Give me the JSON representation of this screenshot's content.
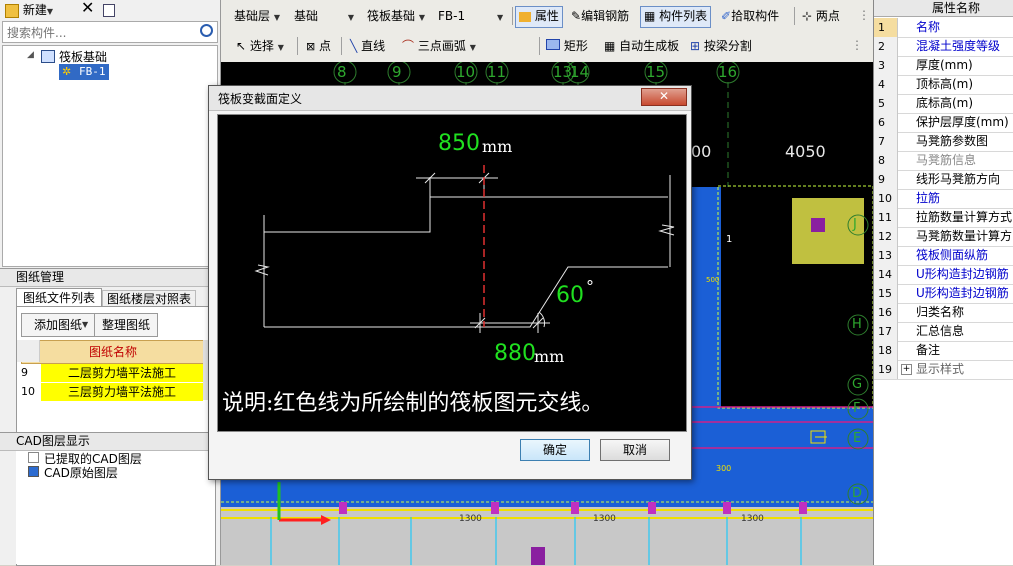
{
  "left_toolbar": {
    "new_label": "新建",
    "search_placeholder": "搜索构件..."
  },
  "tree": {
    "root": "筏板基础",
    "child": "FB-1"
  },
  "drawing_manage": {
    "title": "图纸管理",
    "tabs": [
      "图纸文件列表",
      "图纸楼层对照表"
    ],
    "add_label": "添加图纸",
    "organize_label": "整理图纸",
    "col_header": "图纸名称",
    "rows": [
      {
        "num": "9",
        "name": "二层剪力墙平法施工"
      },
      {
        "num": "10",
        "name": "三层剪力墙平法施工"
      }
    ]
  },
  "cad_layers": {
    "title": "CAD图层显示",
    "items": [
      "已提取的CAD图层",
      "CAD原始图层"
    ]
  },
  "toolbar1": {
    "floor": "基础层",
    "type": "基础",
    "category": "筏板基础",
    "component": "FB-1",
    "attr_label": "属性",
    "edit_rebar_label": "编辑钢筋",
    "comp_list_label": "构件列表",
    "pick_label": "拾取构件",
    "two_point_label": "两点"
  },
  "toolbar2": {
    "select_label": "选择",
    "point_label": "点",
    "line_label": "直线",
    "arc_label": "三点画弧",
    "rect_label": "矩形",
    "auto_label": "自动生成板",
    "split_label": "按梁分割"
  },
  "axes": {
    "top": [
      "8",
      "9",
      "10",
      "11",
      "13",
      "14",
      "15",
      "16"
    ],
    "right": [
      "J",
      "H",
      "G",
      "F",
      "E",
      "D"
    ]
  },
  "cad_dims": {
    "d00": "00",
    "d4050": "4050",
    "d1300a": "1300",
    "d1300b": "1300",
    "d1300c": "1300",
    "d300": "300",
    "d500": "500",
    "d1": "1"
  },
  "props": {
    "header": "属性名称",
    "rows": [
      {
        "num": "1",
        "name": "名称",
        "color": "#0000cc"
      },
      {
        "num": "2",
        "name": "混凝土强度等级",
        "color": "#0000cc"
      },
      {
        "num": "3",
        "name": "厚度(mm)",
        "color": "#000000"
      },
      {
        "num": "4",
        "name": "顶标高(m)",
        "color": "#000000"
      },
      {
        "num": "5",
        "name": "底标高(m)",
        "color": "#000000"
      },
      {
        "num": "6",
        "name": "保护层厚度(mm)",
        "color": "#000000"
      },
      {
        "num": "7",
        "name": "马凳筋参数图",
        "color": "#000000"
      },
      {
        "num": "8",
        "name": "马凳筋信息",
        "color": "#888888"
      },
      {
        "num": "9",
        "name": "线形马凳筋方向",
        "color": "#000000"
      },
      {
        "num": "10",
        "name": "拉筋",
        "color": "#0000cc"
      },
      {
        "num": "11",
        "name": "拉筋数量计算方式",
        "color": "#000000"
      },
      {
        "num": "12",
        "name": "马凳筋数量计算方",
        "color": "#000000"
      },
      {
        "num": "13",
        "name": "筏板侧面纵筋",
        "color": "#0000cc"
      },
      {
        "num": "14",
        "name": "U形构造封边钢筋",
        "color": "#0000cc"
      },
      {
        "num": "15",
        "name": "U形构造封边钢筋",
        "color": "#0000cc"
      },
      {
        "num": "16",
        "name": "归类名称",
        "color": "#000000"
      },
      {
        "num": "17",
        "name": "汇总信息",
        "color": "#000000"
      },
      {
        "num": "18",
        "name": "备注",
        "color": "#000000"
      },
      {
        "num": "19",
        "name": "显示样式",
        "color": "#666666"
      }
    ]
  },
  "dialog": {
    "title": "筏板变截面定义",
    "dim_top_value": "850",
    "dim_top_unit": "mm",
    "dim_bottom_value": "880",
    "dim_bottom_unit": "mm",
    "angle_value": "60",
    "angle_unit": "°",
    "note": "说明:红色线为所绘制的筏板图元交线。",
    "ok_label": "确定",
    "cancel_label": "取消"
  }
}
